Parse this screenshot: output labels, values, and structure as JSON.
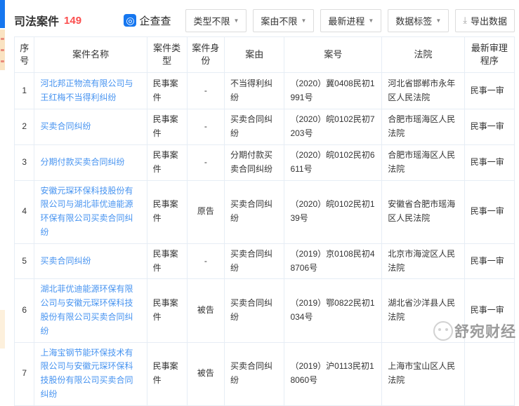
{
  "page": {
    "title": "司法案件",
    "count": "149"
  },
  "brand": {
    "name": "企查查",
    "icon_glyph": "◎",
    "color": "#1677f0"
  },
  "toolbar": {
    "filters": [
      {
        "label": "类型不限"
      },
      {
        "label": "案由不限"
      },
      {
        "label": "最新进程"
      },
      {
        "label": "数据标签"
      }
    ],
    "export_label": "导出数据",
    "caret_glyph": "▼",
    "download_glyph": "⤓"
  },
  "table": {
    "columns": [
      "序号",
      "案件名称",
      "案件类型",
      "案件身份",
      "案由",
      "案号",
      "法院",
      "最新审理程序"
    ],
    "rows": [
      {
        "no": "1",
        "name": "河北邦正物流有限公司与王红梅不当得利纠纷",
        "type": "民事案件",
        "role": "-",
        "cause": "不当得利纠纷",
        "case_no": "（2020）冀0408民初1991号",
        "court": "河北省邯郸市永年区人民法院",
        "procedure": "民事一审"
      },
      {
        "no": "2",
        "name": "买卖合同纠纷",
        "type": "民事案件",
        "role": "-",
        "cause": "买卖合同纠纷",
        "case_no": "（2020）皖0102民初7203号",
        "court": "合肥市瑶海区人民法院",
        "procedure": "民事一审"
      },
      {
        "no": "3",
        "name": "分期付款买卖合同纠纷",
        "type": "民事案件",
        "role": "-",
        "cause": "分期付款买卖合同纠纷",
        "case_no": "（2020）皖0102民初6611号",
        "court": "合肥市瑶海区人民法院",
        "procedure": "民事一审"
      },
      {
        "no": "4",
        "name": "安徽元琛环保科技股份有限公司与湖北菲优迪能源环保有限公司买卖合同纠纷",
        "type": "民事案件",
        "role": "原告",
        "cause": "买卖合同纠纷",
        "case_no": "（2020）皖0102民初139号",
        "court": "安徽省合肥市瑶海区人民法院",
        "procedure": "民事一审"
      },
      {
        "no": "5",
        "name": "买卖合同纠纷",
        "type": "民事案件",
        "role": "-",
        "cause": "买卖合同纠纷",
        "case_no": "（2019）京0108民初48706号",
        "court": "北京市海淀区人民法院",
        "procedure": "民事一审"
      },
      {
        "no": "6",
        "name": "湖北菲优迪能源环保有限公司与安徽元琛环保科技股份有限公司买卖合同纠纷",
        "type": "民事案件",
        "role": "被告",
        "cause": "买卖合同纠纷",
        "case_no": "（2019）鄂0822民初1034号",
        "court": "湖北省沙洋县人民法院",
        "procedure": "民事一审"
      },
      {
        "no": "7",
        "name": "上海宝钢节能环保技术有限公司与安徽元琛环保科技股份有限公司买卖合同纠纷",
        "type": "民事案件",
        "role": "被告",
        "cause": "买卖合同纠纷",
        "case_no": "（2019）沪0113民初18060号",
        "court": "上海市宝山区人民法院",
        "procedure": ""
      }
    ]
  },
  "watermark": {
    "text": "舒宛财经"
  },
  "colors": {
    "accent_blue": "#1677f0",
    "link_blue": "#4693f0",
    "count_red": "#fb4e4e",
    "table_border": "#e6edf5"
  }
}
